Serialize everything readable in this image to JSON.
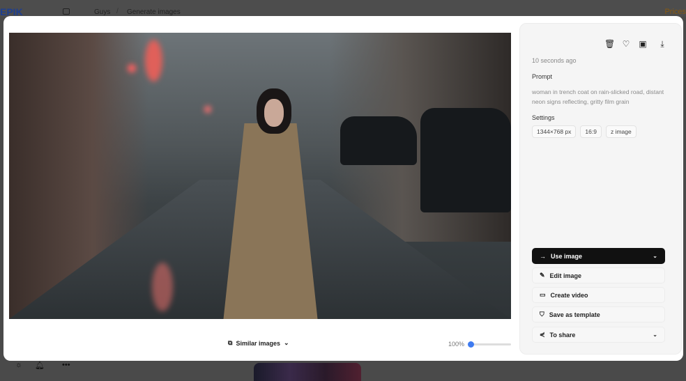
{
  "background": {
    "logo": "EPIK",
    "breadcrumb": [
      "Guys",
      "Generate images"
    ],
    "prices": "Prices"
  },
  "image_viewer": {
    "similar_images_label": "Similar images",
    "zoom_level": "100%",
    "zoom_fraction": 0
  },
  "details": {
    "timestamp": "10 seconds ago",
    "prompt_heading": "Prompt",
    "prompt_text": "woman in trench coat on rain-slicked road, distant neon signs reflecting, gritty film grain",
    "settings_heading": "Settings",
    "settings": [
      "1344×768 px",
      "16:9",
      "z image"
    ],
    "actions": {
      "use_image": "Use image",
      "edit_image": "Edit image",
      "create_video": "Create video",
      "save_template": "Save as template",
      "share": "To share"
    }
  },
  "colors": {
    "primary_button": "#111111",
    "slider_accent": "#3f7bf0"
  }
}
